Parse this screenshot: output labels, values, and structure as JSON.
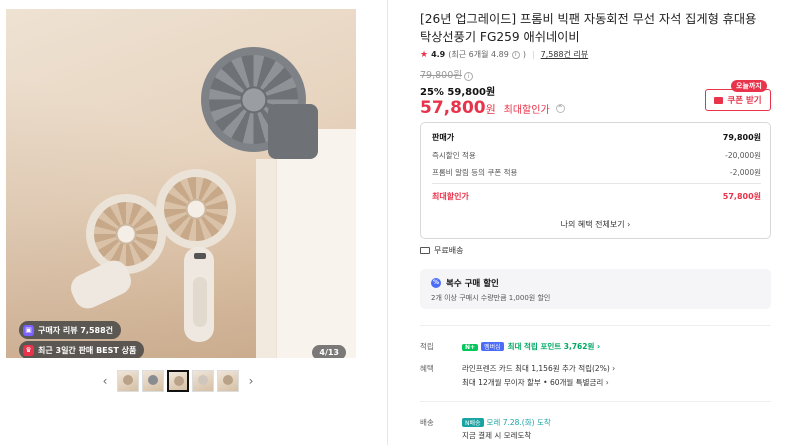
{
  "gallery": {
    "badge_reviews": "구매자 리뷰 7,588건",
    "badge_best": "최근 3일간 판매 BEST 상품",
    "counter": "4/13",
    "prev_arrow": "‹",
    "next_arrow": "›",
    "thumbnail_count": 5,
    "selected_thumbnail": 3
  },
  "product": {
    "title": "[26년 업그레이드] 프롬비 빅팬 자동회전 무선 자석 집게형 휴대용 탁상선풍기 FG259 애쉬네이비",
    "rating": "4.9",
    "rating_detail": "(최근 6개월 4.89",
    "rating_detail_end": ")",
    "review_link": "7,588건 리뷰",
    "original_price": "79,800원",
    "discount_line": "25% 59,800원",
    "final_price": "57,800",
    "won": "원",
    "final_label": "최대할인가",
    "today_tag": "오늘까지",
    "coupon_button": "쿠폰 받기"
  },
  "price_box": {
    "rows": [
      {
        "label": "판매가",
        "value": "79,800원"
      },
      {
        "label": "즉시할인 적용",
        "value": "-20,000원"
      },
      {
        "label": "프롬비 알림 등의 쿠폰 적용",
        "value": "-2,000원"
      }
    ],
    "total_label": "최대할인가",
    "total_value": "57,800원",
    "benefit_link": "나의 혜택 전체보기 ›"
  },
  "shipping_free": "무료배송",
  "multi_buy": {
    "title": "복수 구매 할인",
    "desc": "2개 이상 구매시 수량만큼 1,000원 할인"
  },
  "points": {
    "label": "적립",
    "npay": "N+",
    "npay2": "멤버십",
    "value": "최대 적립 포인트 3,762원 ›"
  },
  "benefits": {
    "label": "혜택",
    "line1": "라인프렌즈 카드 최대 1,156원 추가 적립(2%) ›",
    "line2": "최대 12개월 무이자 할부 • 60개월 특별금리 ›"
  },
  "delivery": {
    "label": "배송",
    "tag": "N배송",
    "value": "모레 7.28.(화) 도착",
    "sub": "지금 결제 시 모레도착"
  },
  "colors": {
    "accent_red": "#e8334a",
    "npay_green": "#03c75a"
  }
}
